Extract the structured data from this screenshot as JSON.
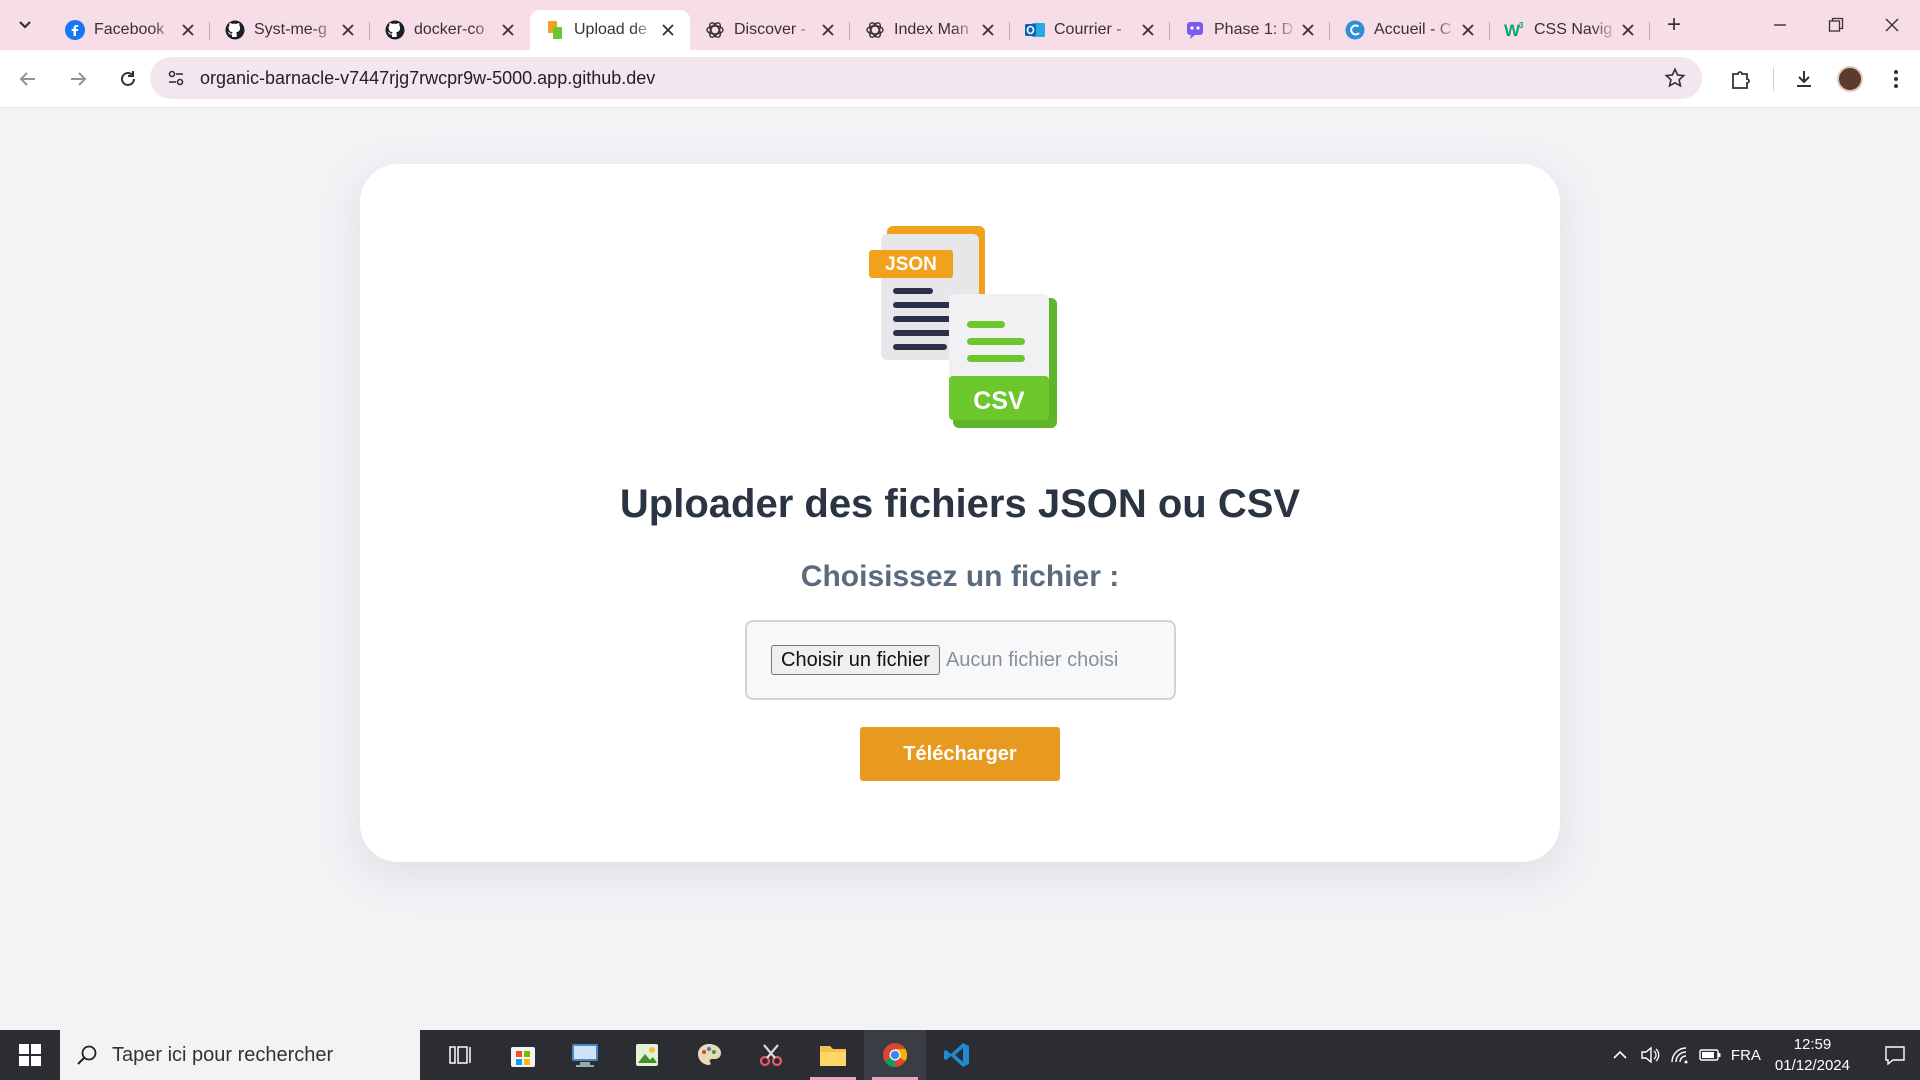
{
  "browser": {
    "tabs": [
      {
        "title": "Facebook",
        "icon": "facebook-icon",
        "active": false
      },
      {
        "title": "Syst-me-g",
        "icon": "github-icon",
        "active": false
      },
      {
        "title": "docker-co",
        "icon": "github-icon",
        "active": false
      },
      {
        "title": "Upload de",
        "icon": "upload-page-icon",
        "active": true
      },
      {
        "title": "Discover -",
        "icon": "openai-icon",
        "active": false
      },
      {
        "title": "Index Man",
        "icon": "openai-icon",
        "active": false
      },
      {
        "title": "Courrier - ",
        "icon": "outlook-icon",
        "active": false
      },
      {
        "title": "Phase 1: D",
        "icon": "bot-icon",
        "active": false
      },
      {
        "title": "Accueil - C",
        "icon": "canva-icon",
        "active": false
      },
      {
        "title": "CSS Navig",
        "icon": "w3schools-icon",
        "active": false
      }
    ],
    "url": "organic-barnacle-v7447rjg7rwcpr9w-5000.app.github.dev"
  },
  "page": {
    "logo": {
      "json_label": "JSON",
      "csv_label": "CSV"
    },
    "title": "Uploader des fichiers JSON ou CSV",
    "subtitle": "Choisissez un fichier :",
    "file_button": "Choisir un fichier",
    "file_status": "Aucun fichier choisi",
    "submit_label": "Télécharger"
  },
  "taskbar": {
    "search_placeholder": "Taper ici pour rechercher",
    "language": "FRA",
    "time": "12:59",
    "date": "01/12/2024"
  },
  "colors": {
    "accent": "#e89920",
    "heading": "#2a3443",
    "subheading": "#5b6b7e",
    "tabstrip": "#f7dde8"
  }
}
